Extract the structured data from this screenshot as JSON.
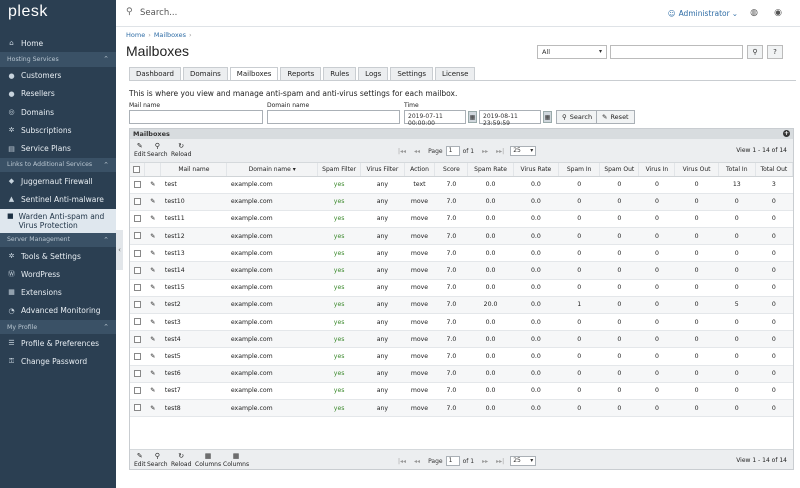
{
  "app": {
    "logo": "plesk"
  },
  "sidebar": {
    "items_main": [
      {
        "label": "Home",
        "icon": "home-icon",
        "glyph": "⌂"
      },
      {
        "label": "Hosting Services",
        "header": true
      },
      {
        "label": "Customers",
        "icon": "user-icon",
        "glyph": "●"
      },
      {
        "label": "Resellers",
        "icon": "users-icon",
        "glyph": "●"
      },
      {
        "label": "Domains",
        "icon": "globe-icon",
        "glyph": "◎"
      },
      {
        "label": "Subscriptions",
        "icon": "gear-icon",
        "glyph": "✲"
      },
      {
        "label": "Service Plans",
        "icon": "plans-icon",
        "glyph": "▤"
      },
      {
        "label": "Links to Additional Services",
        "header": true
      },
      {
        "label": "Juggernaut Firewall",
        "icon": "firewall-icon",
        "glyph": "◆"
      },
      {
        "label": "Sentinel Anti-malware",
        "icon": "shield-icon",
        "glyph": "▲"
      },
      {
        "label": "Warden Anti-spam and Virus Protection",
        "icon": "warden-icon",
        "glyph": "■",
        "active": true
      },
      {
        "label": "Server Management",
        "header": true
      },
      {
        "label": "Tools & Settings",
        "icon": "tools-icon",
        "glyph": "✲"
      },
      {
        "label": "WordPress",
        "icon": "wordpress-icon",
        "glyph": "Ⓦ"
      },
      {
        "label": "Extensions",
        "icon": "extensions-icon",
        "glyph": "▦"
      },
      {
        "label": "Advanced Monitoring",
        "icon": "monitoring-icon",
        "glyph": "◔"
      },
      {
        "label": "My Profile",
        "header": true
      },
      {
        "label": "Profile & Preferences",
        "icon": "profile-icon",
        "glyph": "☰"
      },
      {
        "label": "Change Password",
        "icon": "key-icon",
        "glyph": "⚿"
      }
    ]
  },
  "topbar": {
    "search_placeholder": "Search...",
    "user": "Administrator"
  },
  "breadcrumb": {
    "home": "Home",
    "current": "Mailboxes",
    "sep": "›"
  },
  "page": {
    "title": "Mailboxes",
    "filter_select": "All",
    "intro": "This is where you view and manage anti-spam and anti-virus settings for each mailbox."
  },
  "tabs": [
    "Dashboard",
    "Domains",
    "Mailboxes",
    "Reports",
    "Rules",
    "Logs",
    "Settings",
    "License"
  ],
  "active_tab": "Mailboxes",
  "filters": {
    "mail_name_label": "Mail name",
    "domain_name_label": "Domain name",
    "time_label": "Time",
    "time_from": "2019-07-11 00:00:00",
    "time_to": "2019-08-11 23:59:59",
    "search_button": "Search",
    "reset_button": "Reset"
  },
  "grid": {
    "title": "Mailboxes",
    "toolbar": {
      "edit": "Edit",
      "search": "Search",
      "reload": "Reload",
      "columns": "Columns"
    },
    "pager": {
      "page_label": "Page",
      "page": "1",
      "of": "of 1",
      "per_page": "25"
    },
    "view_count_top": "View 1 - 14 of 14",
    "view_count_bottom": "View 1 - 14 of 14",
    "columns": [
      "Mail name",
      "Domain name ▾",
      "Spam Filter",
      "Virus Filter",
      "Action",
      "Score",
      "Spam Rate",
      "Virus Rate",
      "Spam In",
      "Spam Out",
      "Virus In",
      "Virus Out",
      "Total In",
      "Total Out"
    ],
    "rows": [
      [
        "test",
        "example.com",
        "yes",
        "any",
        "text",
        "7.0",
        "0.0",
        "0.0",
        "0",
        "0",
        "0",
        "0",
        "13",
        "3"
      ],
      [
        "test10",
        "example.com",
        "yes",
        "any",
        "move",
        "7.0",
        "0.0",
        "0.0",
        "0",
        "0",
        "0",
        "0",
        "0",
        "0"
      ],
      [
        "test11",
        "example.com",
        "yes",
        "any",
        "move",
        "7.0",
        "0.0",
        "0.0",
        "0",
        "0",
        "0",
        "0",
        "0",
        "0"
      ],
      [
        "test12",
        "example.com",
        "yes",
        "any",
        "move",
        "7.0",
        "0.0",
        "0.0",
        "0",
        "0",
        "0",
        "0",
        "0",
        "0"
      ],
      [
        "test13",
        "example.com",
        "yes",
        "any",
        "move",
        "7.0",
        "0.0",
        "0.0",
        "0",
        "0",
        "0",
        "0",
        "0",
        "0"
      ],
      [
        "test14",
        "example.com",
        "yes",
        "any",
        "move",
        "7.0",
        "0.0",
        "0.0",
        "0",
        "0",
        "0",
        "0",
        "0",
        "0"
      ],
      [
        "test15",
        "example.com",
        "yes",
        "any",
        "move",
        "7.0",
        "0.0",
        "0.0",
        "0",
        "0",
        "0",
        "0",
        "0",
        "0"
      ],
      [
        "test2",
        "example.com",
        "yes",
        "any",
        "move",
        "7.0",
        "20.0",
        "0.0",
        "1",
        "0",
        "0",
        "0",
        "5",
        "0"
      ],
      [
        "test3",
        "example.com",
        "yes",
        "any",
        "move",
        "7.0",
        "0.0",
        "0.0",
        "0",
        "0",
        "0",
        "0",
        "0",
        "0"
      ],
      [
        "test4",
        "example.com",
        "yes",
        "any",
        "move",
        "7.0",
        "0.0",
        "0.0",
        "0",
        "0",
        "0",
        "0",
        "0",
        "0"
      ],
      [
        "test5",
        "example.com",
        "yes",
        "any",
        "move",
        "7.0",
        "0.0",
        "0.0",
        "0",
        "0",
        "0",
        "0",
        "0",
        "0"
      ],
      [
        "test6",
        "example.com",
        "yes",
        "any",
        "move",
        "7.0",
        "0.0",
        "0.0",
        "0",
        "0",
        "0",
        "0",
        "0",
        "0"
      ],
      [
        "test7",
        "example.com",
        "yes",
        "any",
        "move",
        "7.0",
        "0.0",
        "0.0",
        "0",
        "0",
        "0",
        "0",
        "0",
        "0"
      ],
      [
        "test8",
        "example.com",
        "yes",
        "any",
        "move",
        "7.0",
        "0.0",
        "0.0",
        "0",
        "0",
        "0",
        "0",
        "0",
        "0"
      ]
    ]
  },
  "colors": {
    "sidebar_bg": "#2b3f52",
    "link": "#2f6da6",
    "yes_green": "#3d8a2e"
  }
}
